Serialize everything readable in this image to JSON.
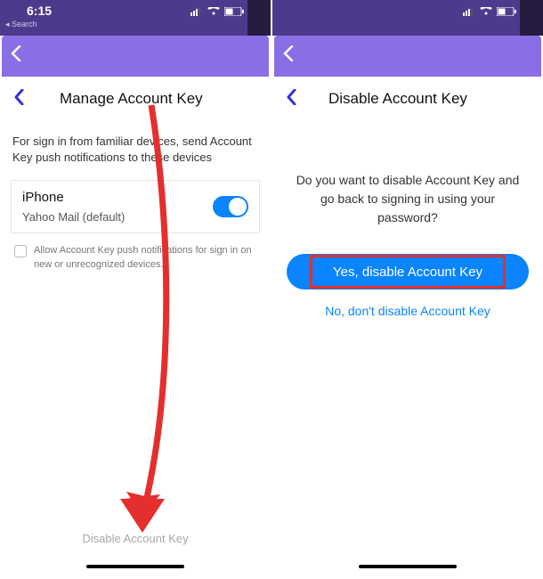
{
  "status": {
    "time": "6:15",
    "search_back": "◂ Search"
  },
  "left": {
    "title": "Manage Account Key",
    "description": "For sign in from familiar devices, send Account Key push notifications to these devices",
    "device_name": "iPhone",
    "device_sub": "Yahoo Mail (default)",
    "allow_text": "Allow Account Key push notifications for sign in on new or unrecognized devices.",
    "disable_link": "Disable Account Key"
  },
  "right": {
    "title": "Disable Account Key",
    "prompt": "Do you want to disable Account Key and go back to signing in using your password?",
    "yes_label": "Yes, disable Account Key",
    "no_label": "No, don't disable Account Key"
  }
}
